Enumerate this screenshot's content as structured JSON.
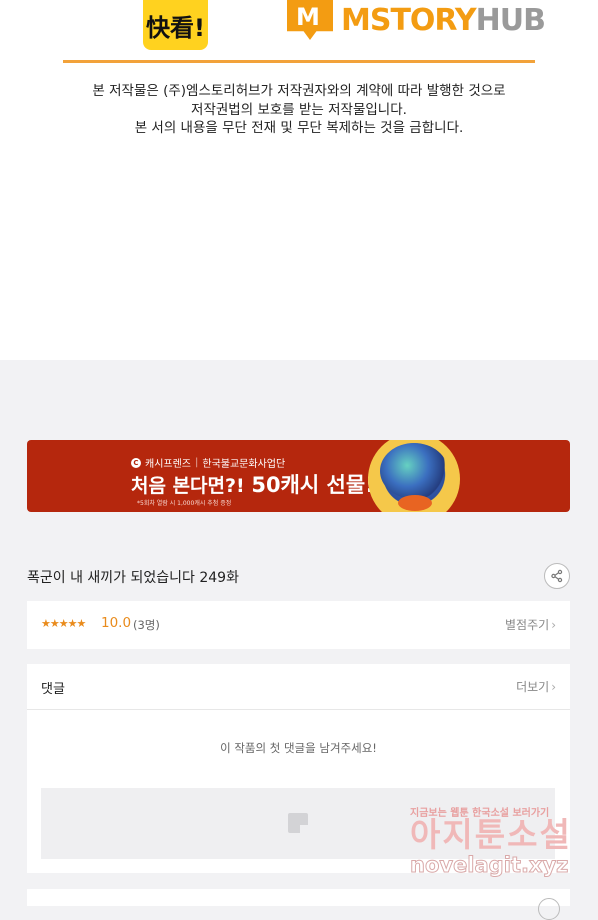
{
  "logos": {
    "kakao_text": "快看!",
    "mstory_main": "MSTORY",
    "mstory_hub": "HUB",
    "mstory_icon_letter": "M"
  },
  "copyright": {
    "line1": "본 저작물은 (주)엠스토리허브가 저작권자와의 계약에 따라 발행한 것으로",
    "line2": "저작권법의 보호를 받는 저작물입니다.",
    "line3": "본 서의 내용을 무단 전재 및 무단 복제하는 것을 금합니다."
  },
  "banner": {
    "brand": "캐시프렌즈",
    "partner": "한국불교문화사업단",
    "headline_prefix": "처음 본다면?!",
    "headline_strong": "50캐시 선물!!",
    "fineprint": "*5회차 열람 시 1,000캐시 추첨 증정"
  },
  "episode": {
    "title": "폭군이 내 새끼가 되었습니다 249화"
  },
  "rating": {
    "stars": "★★★★★",
    "score": "10.0",
    "count": "(3명)",
    "rate_link": "별점주기"
  },
  "comments": {
    "label": "댓글",
    "more_link": "더보기",
    "empty_message": "이 작품의 첫 댓글을 남겨주세요!"
  },
  "watermark": {
    "top": "지금보는 웹툰 한국소설 보러가기",
    "middle": "아지툰소설",
    "bottom": "novelagit.xyz"
  },
  "colors": {
    "accent": "#e98b1c",
    "mstory_orange": "#f39c12",
    "banner_red": "#b5270d",
    "kakao_yellow": "#ffd21f"
  }
}
